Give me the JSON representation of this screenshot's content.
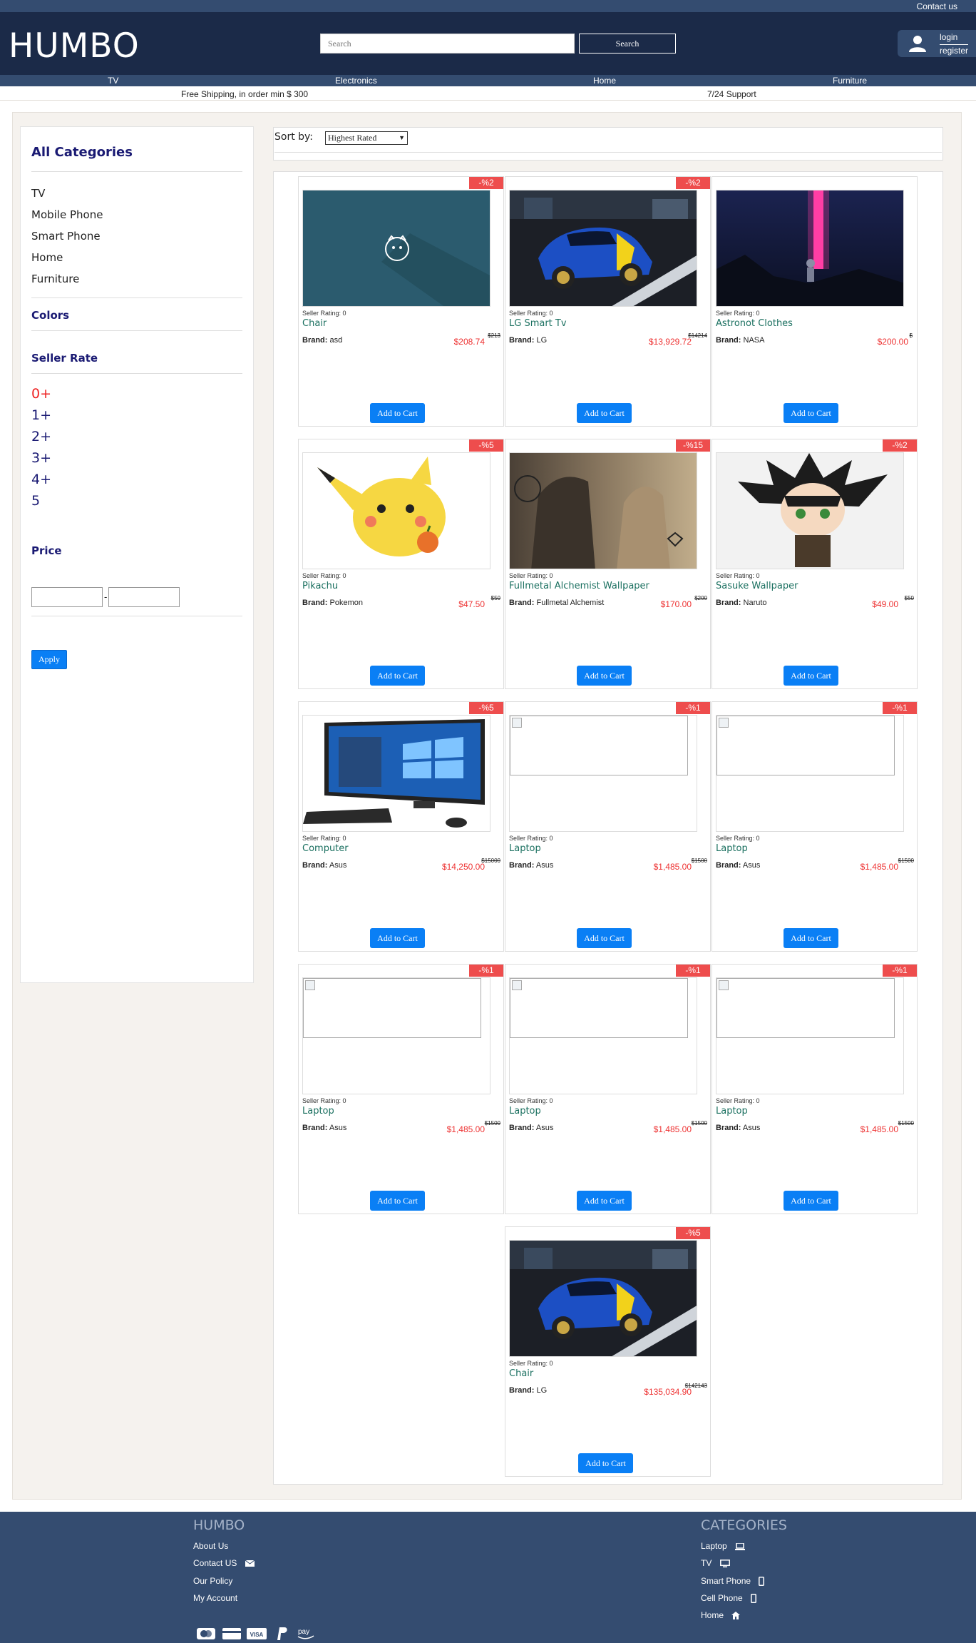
{
  "topbar": {
    "contact": "Contact us"
  },
  "header": {
    "logo": "HUMBO",
    "search_placeholder": "Search",
    "search_button": "Search",
    "login": "login",
    "register": "register"
  },
  "nav": [
    "TV",
    "Electronics",
    "Home",
    "Furniture"
  ],
  "shipping": {
    "left": "Free Shipping, in order min $ 300",
    "right": "7/24 Support"
  },
  "sidebar": {
    "categories_title": "All Categories",
    "categories": [
      "TV",
      "Mobile Phone",
      "Smart Phone",
      "Home",
      "Furniture"
    ],
    "colors_title": "Colors",
    "seller_rate_title": "Seller Rate",
    "rates": [
      "0+",
      "1+",
      "2+",
      "3+",
      "4+",
      "5"
    ],
    "price_title": "Price",
    "price_separator": "-",
    "apply": "Apply"
  },
  "sort": {
    "label": "Sort by:",
    "selected": "Highest Rated"
  },
  "colors": {
    "accent": "#0a7ff5",
    "badge": "#ee4d4d",
    "header": "#1b2a48",
    "bar": "#344c70",
    "price": "#ee3333",
    "name": "#1b7060"
  },
  "products": [
    {
      "badge": "-%2",
      "rating": "Seller Rating: 0",
      "name": "Chair",
      "brand_label": "Brand:",
      "brand": "asd",
      "price": "$208.74",
      "old": "$213",
      "cart": "Add to Cart",
      "image": "placeholder"
    },
    {
      "badge": "-%2",
      "rating": "Seller Rating: 0",
      "name": "LG Smart Tv",
      "brand_label": "Brand:",
      "brand": "LG",
      "price": "$13,929.72",
      "old": "$14214",
      "cart": "Add to Cart",
      "image": "car"
    },
    {
      "badge": "",
      "rating": "Seller Rating: 0",
      "name": "Astronot Clothes",
      "brand_label": "Brand:",
      "brand": "NASA",
      "price": "$200.00",
      "old": "$",
      "cart": "Add to Cart",
      "image": "astronaut"
    },
    {
      "badge": "-%5",
      "rating": "Seller Rating: 0",
      "name": "Pikachu",
      "brand_label": "Brand:",
      "brand": "Pokemon",
      "price": "$47.50",
      "old": "$50",
      "cart": "Add to Cart",
      "image": "pikachu"
    },
    {
      "badge": "-%15",
      "rating": "Seller Rating: 0",
      "name": "Fullmetal Alchemist Wallpaper",
      "brand_label": "Brand:",
      "brand": "Fullmetal Alchemist",
      "price": "$170.00",
      "old": "$200",
      "cart": "Add to Cart",
      "image": "fma"
    },
    {
      "badge": "-%2",
      "rating": "Seller Rating: 0",
      "name": "Sasuke Wallpaper",
      "brand_label": "Brand:",
      "brand": "Naruto",
      "price": "$49.00",
      "old": "$50",
      "cart": "Add to Cart",
      "image": "sasuke"
    },
    {
      "badge": "-%5",
      "rating": "Seller Rating: 0",
      "name": "Computer",
      "brand_label": "Brand:",
      "brand": "Asus",
      "price": "$14,250.00",
      "old": "$15000",
      "cart": "Add to Cart",
      "image": "computer"
    },
    {
      "badge": "-%1",
      "rating": "Seller Rating: 0",
      "name": "Laptop",
      "brand_label": "Brand:",
      "brand": "Asus",
      "price": "$1,485.00",
      "old": "$1500",
      "cart": "Add to Cart",
      "image": "broken"
    },
    {
      "badge": "-%1",
      "rating": "Seller Rating: 0",
      "name": "Laptop",
      "brand_label": "Brand:",
      "brand": "Asus",
      "price": "$1,485.00",
      "old": "$1500",
      "cart": "Add to Cart",
      "image": "broken"
    },
    {
      "badge": "-%1",
      "rating": "Seller Rating: 0",
      "name": "Laptop",
      "brand_label": "Brand:",
      "brand": "Asus",
      "price": "$1,485.00",
      "old": "$1500",
      "cart": "Add to Cart",
      "image": "broken"
    },
    {
      "badge": "-%1",
      "rating": "Seller Rating: 0",
      "name": "Laptop",
      "brand_label": "Brand:",
      "brand": "Asus",
      "price": "$1,485.00",
      "old": "$1500",
      "cart": "Add to Cart",
      "image": "broken"
    },
    {
      "badge": "-%1",
      "rating": "Seller Rating: 0",
      "name": "Laptop",
      "brand_label": "Brand:",
      "brand": "Asus",
      "price": "$1,485.00",
      "old": "$1500",
      "cart": "Add to Cart",
      "image": "broken"
    },
    {
      "badge": "-%5",
      "rating": "Seller Rating: 0",
      "name": "Chair",
      "brand_label": "Brand:",
      "brand": "LG",
      "price": "$135,034.90",
      "old": "$142143",
      "cart": "Add to Cart",
      "image": "car"
    }
  ],
  "footer": {
    "brand": "HUMBO",
    "links": [
      "About Us",
      "Contact US",
      "Our Policy",
      "My Account"
    ],
    "categories_title": "CATEGORIES",
    "categories": [
      "Laptop",
      "TV",
      "Smart Phone",
      "Cell Phone",
      "Home"
    ],
    "payment_icons": [
      "mastercard-icon",
      "credit-card-icon",
      "visa-icon",
      "paypal-icon",
      "amazon-pay-icon"
    ]
  }
}
